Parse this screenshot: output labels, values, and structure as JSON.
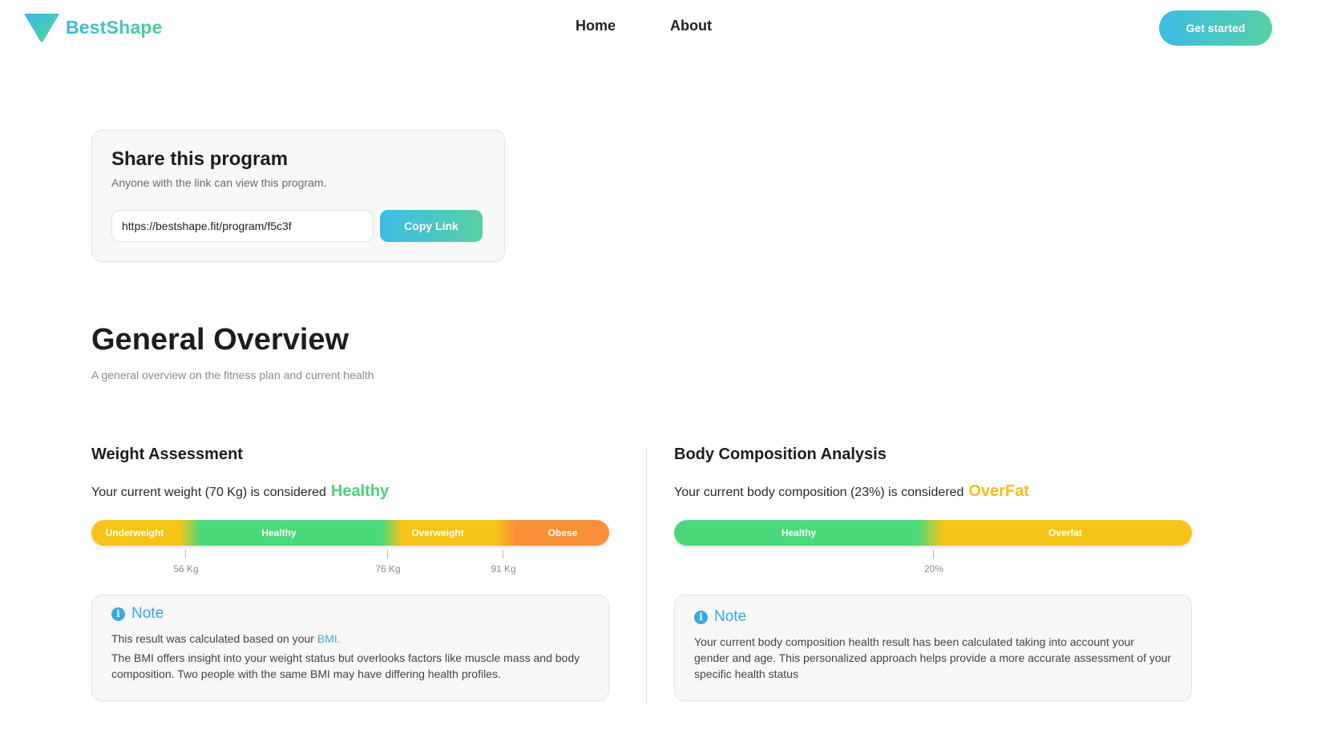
{
  "brand": {
    "name": "BestShape"
  },
  "nav": {
    "home": "Home",
    "about": "About",
    "cta": "Get started"
  },
  "share": {
    "title": "Share this program",
    "subtitle": "Anyone with the link can view this program.",
    "url": "https://bestshape.fit/program/f5c3f",
    "copy_label": "Copy Link"
  },
  "overview": {
    "title": "General Overview",
    "subtitle": "A general overview on the fitness plan and current health"
  },
  "weight": {
    "title": "Weight Assessment",
    "status_prefix": "Your current weight (70 Kg) is considered",
    "status_value": "Healthy",
    "status_color": "#4cd07a",
    "segments": [
      "Underweight",
      "Healthy",
      "Overweight",
      "Obese"
    ],
    "ticks": [
      "56 Kg",
      "76 Kg",
      "91 Kg"
    ],
    "note": {
      "title": "Note",
      "line1_prefix": "This result was calculated based on your ",
      "line1_link": "BMI.",
      "line2": "The BMI offers insight into your weight status but overlooks factors like muscle mass and body composition. Two people with the same BMI may have differing health profiles."
    }
  },
  "body": {
    "title": "Body Composition Analysis",
    "status_prefix": "Your current body composition (23%) is considered",
    "status_value": "OverFat",
    "status_color": "#f5bf16",
    "segments": [
      "Healthy",
      "Overfat"
    ],
    "ticks": [
      "20%"
    ],
    "note": {
      "title": "Note",
      "text": "Your current body composition health result has been calculated taking into account your gender and age. This personalized approach helps provide a more accurate assessment of your specific health status"
    }
  },
  "colors": {
    "yellow": "#f6c419",
    "green": "#4cd97b",
    "orange": "#fa8f3a",
    "accent": "#3cbce6"
  }
}
